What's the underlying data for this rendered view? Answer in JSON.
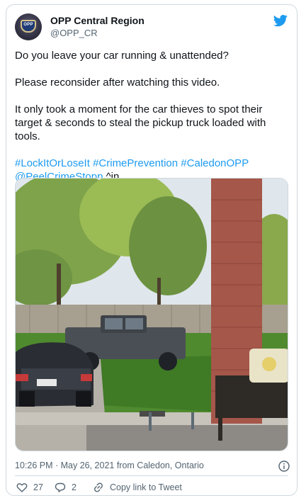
{
  "account": {
    "name": "OPP Central Region",
    "handle": "@OPP_CR",
    "avatar_text": "OPP"
  },
  "tweet": {
    "line1": "Do you leave your car running & unattended?",
    "line2": "Please reconsider after watching this video.",
    "line3": "It only took a moment for the car thieves to spot their target & seconds to steal the pickup truck loaded with tools.",
    "hashtags": [
      "#LockItOrLoseIt",
      "#CrimePrevention",
      "#CaledonOPP"
    ],
    "mention": "@PeelCrimeStopp",
    "signature": "^in"
  },
  "meta": {
    "timestamp": "10:26 PM · May 26, 2021 from Caledon, Ontario"
  },
  "actions": {
    "likes": "27",
    "replies": "2",
    "copy_link": "Copy link to Tweet"
  },
  "icons": {
    "brand": "twitter-bird-icon",
    "info": "info-icon",
    "like": "heart-icon",
    "reply": "reply-icon",
    "copy": "link-icon"
  },
  "colors": {
    "link": "#1d9bf0",
    "text": "#0f1419",
    "muted": "#536471",
    "border": "#cfd9de"
  }
}
